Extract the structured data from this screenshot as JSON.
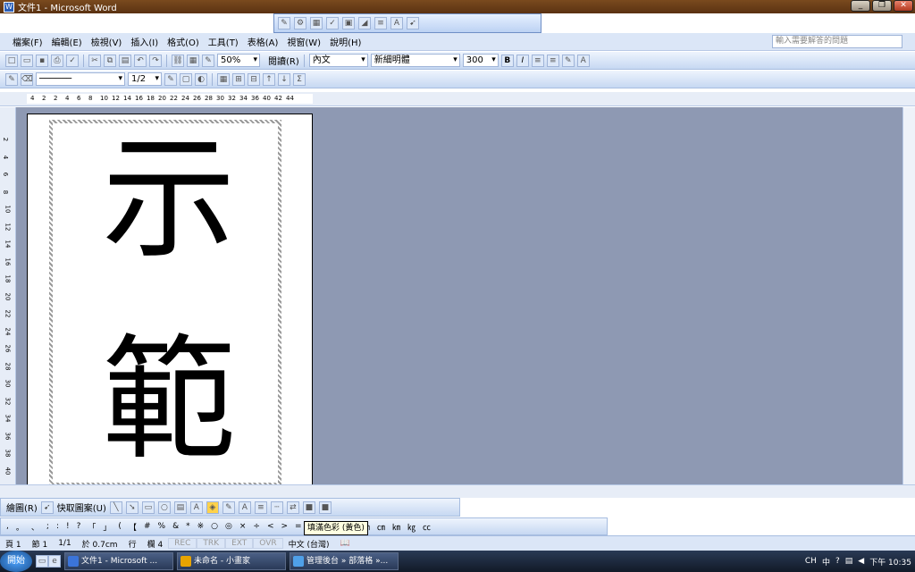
{
  "window": {
    "title": "文件1 - Microsoft Word",
    "app_icon": "W"
  },
  "menus": [
    "檔案(F)",
    "編輯(E)",
    "檢視(V)",
    "插入(I)",
    "格式(O)",
    "工具(T)",
    "表格(A)",
    "視窗(W)",
    "說明(H)"
  ],
  "help_box": {
    "placeholder": "輸入需要解答的問題"
  },
  "standard_toolbar": {
    "zoom": "50%",
    "read_label": "閱讀(R)",
    "style": "內文",
    "font": "新細明體",
    "size": "300",
    "bold": "B",
    "italic": "I"
  },
  "tables_toolbar": {
    "line_weight": "1/2"
  },
  "ruler": {
    "ticks": [
      "4",
      "2",
      "2",
      "4",
      "6",
      "8",
      "10",
      "12",
      "14",
      "16",
      "18",
      "20",
      "22",
      "24",
      "26",
      "28",
      "30",
      "32",
      "34",
      "36",
      "40",
      "42",
      "44"
    ]
  },
  "vruler": {
    "ticks": [
      "2",
      "4",
      "6",
      "8",
      "10",
      "12",
      "14",
      "16",
      "18",
      "20",
      "22",
      "24",
      "26",
      "28",
      "30",
      "32",
      "34",
      "36",
      "38",
      "40"
    ]
  },
  "document": {
    "char1": "示",
    "char2": "範"
  },
  "drawing_toolbar": {
    "draw_label": "繪圖(R)",
    "autoshapes_label": "快取圖案(U)"
  },
  "symbol_toolbar": {
    "symbols": [
      ",",
      "。",
      "、",
      ";",
      ":",
      "!",
      "?",
      "「",
      "」",
      "(",
      "【",
      "#",
      "%",
      "&",
      "*",
      "※",
      "○",
      "◎",
      "×",
      "÷",
      "<",
      ">",
      "=",
      "$",
      "¥",
      "€",
      "℃",
      "㎜",
      "㎝",
      "㎞",
      "㎏",
      "㏄"
    ]
  },
  "tooltip": "填滿色彩 (黃色)",
  "status": {
    "page": "頁 1",
    "section": "節 1",
    "pages": "1/1",
    "at": "於 0.7cm",
    "line": "行",
    "col": "欄 4",
    "rec": "REC",
    "trk": "TRK",
    "ext": "EXT",
    "ovr": "OVR",
    "lang": "中文 (台灣)"
  },
  "taskbar": {
    "start": "開始",
    "tasks": [
      "文件1 - Microsoft ...",
      "未命名 - 小畫家",
      "管理後台 » 部落格 »..."
    ],
    "lang": "CH",
    "ime": "中",
    "clock": "下午 10:35"
  }
}
